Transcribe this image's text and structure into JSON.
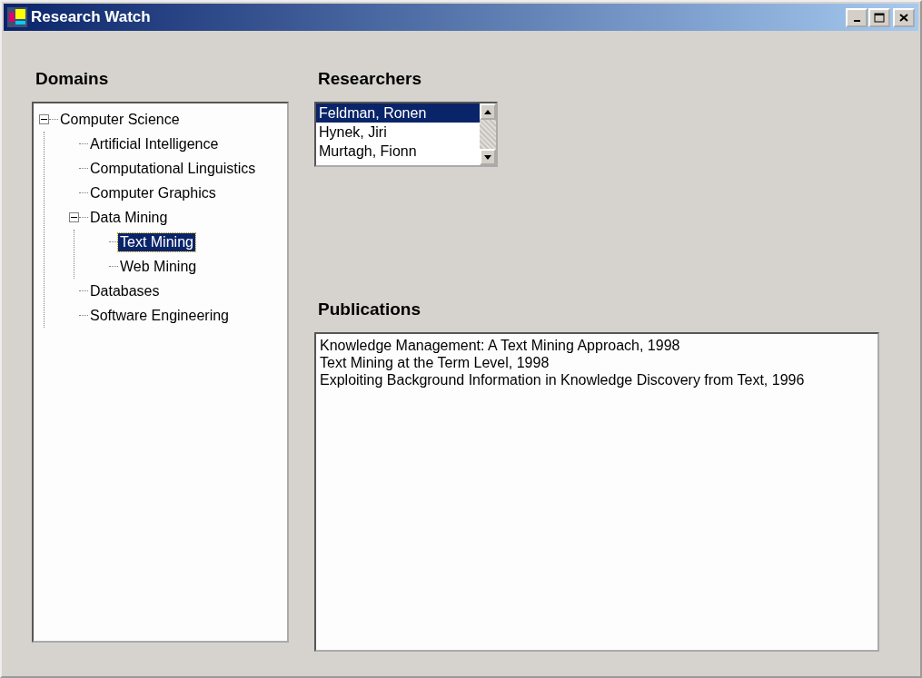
{
  "window": {
    "title": "Research Watch"
  },
  "domains": {
    "heading": "Domains",
    "tree": [
      {
        "label": "Computer Science",
        "expanded": true,
        "selected": false,
        "children": [
          {
            "label": "Artificial Intelligence",
            "selected": false
          },
          {
            "label": "Computational Linguistics",
            "selected": false
          },
          {
            "label": "Computer Graphics",
            "selected": false
          },
          {
            "label": "Data Mining",
            "expanded": true,
            "selected": false,
            "children": [
              {
                "label": "Text Mining",
                "selected": true
              },
              {
                "label": "Web Mining",
                "selected": false
              }
            ]
          },
          {
            "label": "Databases",
            "selected": false
          },
          {
            "label": "Software Engineering",
            "selected": false
          }
        ]
      }
    ]
  },
  "researchers": {
    "heading": "Researchers",
    "items": [
      {
        "label": "Feldman, Ronen",
        "selected": true
      },
      {
        "label": "Hynek, Jiri",
        "selected": false
      },
      {
        "label": "Murtagh, Fionn",
        "selected": false
      }
    ]
  },
  "publications": {
    "heading": "Publications",
    "items": [
      "Knowledge Management: A Text Mining Approach, 1998",
      "Text Mining at the Term Level, 1998",
      "Exploiting Background Information in Knowledge Discovery from Text, 1996"
    ]
  }
}
